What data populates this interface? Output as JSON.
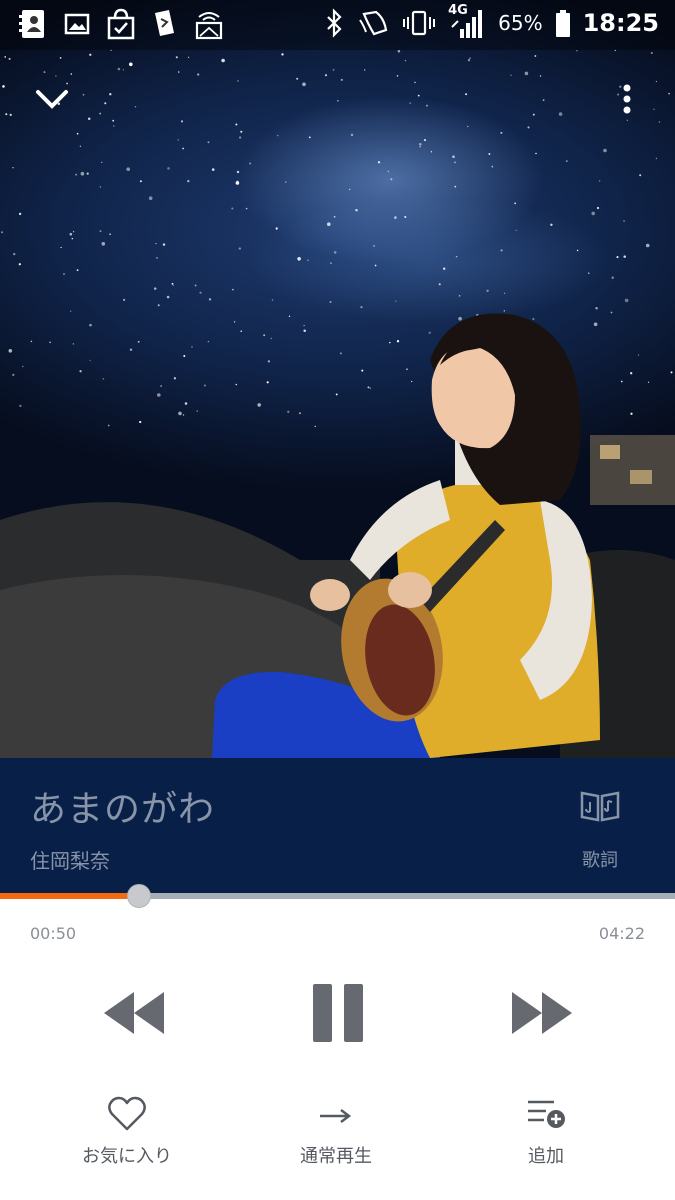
{
  "status_bar": {
    "left_icons": [
      "contacts-icon",
      "gallery-icon",
      "shopping-bag-icon",
      "sim-toolkit-icon",
      "screencast-icon"
    ],
    "right_icons": [
      "bluetooth-icon",
      "nfc-icon",
      "vibrate-icon",
      "signal-icon",
      "battery-icon"
    ],
    "network": "4G",
    "battery": "65%",
    "time": "18:25"
  },
  "player": {
    "collapse_icon": "chevron-down-icon",
    "more_icon": "more-vertical-icon",
    "title": "あまのがわ",
    "artist": "住岡梨奈",
    "lyrics_label": "歌詞",
    "elapsed": "00:50",
    "duration": "04:22",
    "progress": 0.19
  },
  "controls": {
    "previous_icon": "rewind-icon",
    "pause_icon": "pause-icon",
    "next_icon": "fast-forward-icon"
  },
  "actions": {
    "favorite_label": "お気に入り",
    "play_mode_label": "通常再生",
    "add_label": "追加"
  },
  "colors": {
    "accent": "#f36a10",
    "panel": "#082047",
    "panel_text": "#8894a8"
  }
}
